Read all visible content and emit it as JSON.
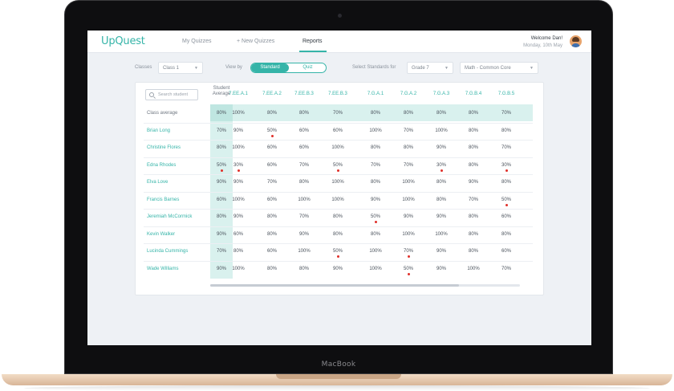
{
  "device": {
    "brand": "MacBook"
  },
  "header": {
    "logo": "UpQuest",
    "nav": [
      {
        "label": "My Quizzes"
      },
      {
        "label": "+ New Quizzes"
      },
      {
        "label": "Reports"
      }
    ],
    "active_nav": "Reports",
    "welcome": "Welcome Dan!",
    "date": "Monday, 10th May"
  },
  "filters": {
    "classes_label": "Classes",
    "class_value": "Class 1",
    "view_by_label": "View by",
    "view_options": [
      "Standard",
      "Quiz"
    ],
    "view_selected": "Standard",
    "standards_label": "Select Standards for",
    "grade_value": "Grade 7",
    "subject_value": "Math - Common Core"
  },
  "table": {
    "search_placeholder": "Search student",
    "avg_header_1": "Student",
    "avg_header_2": "Average",
    "columns": [
      "7.EE.A.1",
      "7.EE.A.2",
      "7.EE.B.3",
      "7.EE.B.3",
      "7.G.A.1",
      "7.G.A.2",
      "7.G.A.3",
      "7.G.B.4",
      "7.G.B.5"
    ],
    "class_avg": {
      "name": "Class average",
      "avg": "80%",
      "values": [
        "100%",
        "80%",
        "80%",
        "70%",
        "80%",
        "80%",
        "80%",
        "80%",
        "70%"
      ]
    },
    "rows": [
      {
        "name": "Brian Long",
        "avg": "70%",
        "values": [
          "90%",
          "50%",
          "60%",
          "60%",
          "100%",
          "70%",
          "100%",
          "80%",
          "80%"
        ],
        "flags": [
          2
        ],
        "avg_flag": false
      },
      {
        "name": "Christine Flores",
        "avg": "80%",
        "values": [
          "100%",
          "60%",
          "60%",
          "100%",
          "80%",
          "80%",
          "90%",
          "80%",
          "70%"
        ],
        "flags": [],
        "avg_flag": false
      },
      {
        "name": "Edna Rhodes",
        "avg": "50%",
        "values": [
          "30%",
          "60%",
          "70%",
          "50%",
          "70%",
          "70%",
          "30%",
          "80%",
          "30%"
        ],
        "flags": [
          1,
          4,
          7,
          9
        ],
        "avg_flag": true
      },
      {
        "name": "Elva Love",
        "avg": "90%",
        "values": [
          "90%",
          "70%",
          "80%",
          "100%",
          "80%",
          "100%",
          "80%",
          "90%",
          "80%"
        ],
        "flags": [],
        "avg_flag": false
      },
      {
        "name": "Francis Barnes",
        "avg": "60%",
        "values": [
          "100%",
          "60%",
          "100%",
          "100%",
          "90%",
          "100%",
          "80%",
          "70%",
          "50%"
        ],
        "flags": [
          9
        ],
        "avg_flag": false
      },
      {
        "name": "Jeremiah McCormick",
        "avg": "80%",
        "values": [
          "90%",
          "80%",
          "70%",
          "80%",
          "50%",
          "90%",
          "90%",
          "80%",
          "60%"
        ],
        "flags": [
          5
        ],
        "avg_flag": false
      },
      {
        "name": "Kevin Walker",
        "avg": "90%",
        "values": [
          "60%",
          "80%",
          "90%",
          "80%",
          "80%",
          "100%",
          "100%",
          "80%",
          "80%"
        ],
        "flags": [],
        "avg_flag": false
      },
      {
        "name": "Lucinda Cummings",
        "avg": "70%",
        "values": [
          "80%",
          "60%",
          "100%",
          "50%",
          "100%",
          "70%",
          "90%",
          "80%",
          "60%"
        ],
        "flags": [
          4,
          6
        ],
        "avg_flag": false
      },
      {
        "name": "Wade Williams",
        "avg": "90%",
        "values": [
          "100%",
          "80%",
          "80%",
          "90%",
          "100%",
          "50%",
          "90%",
          "100%",
          "70%"
        ],
        "flags": [
          6
        ],
        "avg_flag": false
      }
    ]
  },
  "colors": {
    "accent": "#35b4a8",
    "alert": "#e0302a",
    "avg_band": "#d9f1ee"
  }
}
